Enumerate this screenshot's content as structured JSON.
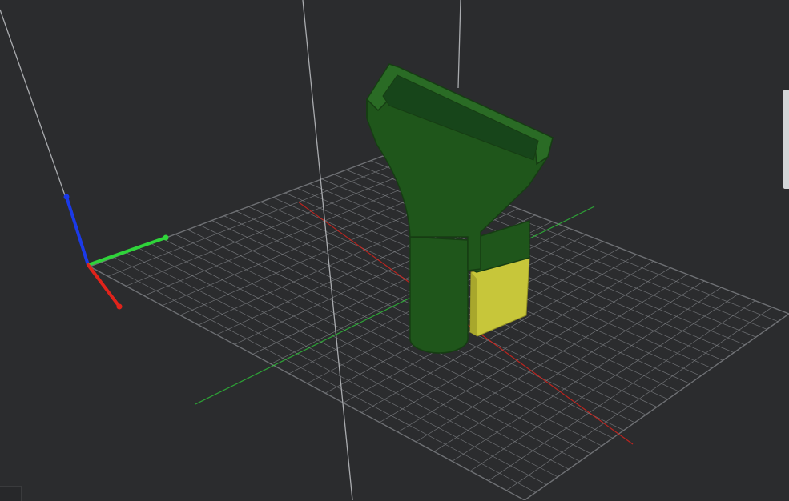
{
  "viewport": {
    "background_color": "#2b2c2e",
    "grid_color": "#7a7c80",
    "grid_divisions": 24
  },
  "axes": {
    "x_color": "#e0231b",
    "y_color": "#2fd43a",
    "z_color": "#1b3ae8"
  },
  "model": {
    "part_color": "#1f561b",
    "part_edge_color": "#163d13",
    "highlight_color": "#c7c63a"
  },
  "icons": {
    "x_axis_arrow": "arrow-x-icon",
    "y_axis_arrow": "arrow-y-icon",
    "z_axis_arrow": "arrow-z-icon"
  }
}
